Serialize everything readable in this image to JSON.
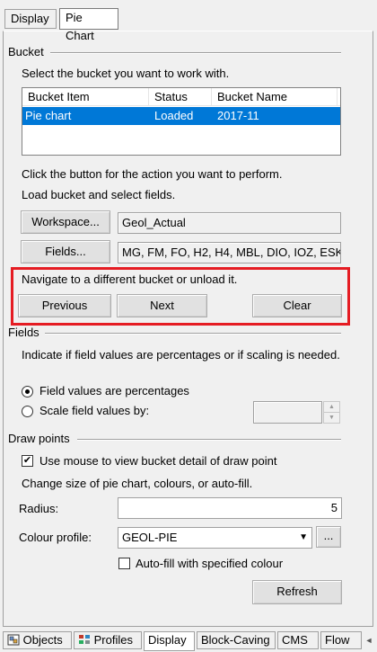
{
  "top_tabs": [
    "Display",
    "Pie Chart"
  ],
  "bucket": {
    "group_title": "Bucket",
    "instruction": "Select the bucket you want to work with.",
    "columns": [
      "Bucket Item",
      "Status",
      "Bucket Name"
    ],
    "rows": [
      {
        "item": "Pie chart",
        "status": "Loaded",
        "name": "2017-11"
      }
    ],
    "action_text": "Click the button for the action you want to perform.",
    "load_text": "Load bucket and select fields.",
    "workspace_button": "Workspace...",
    "workspace_value": "Geol_Actual",
    "fields_button": "Fields...",
    "fields_value": "MG, FM, FO, H2, H4, MBL, DIO, IOZ, ESK,",
    "navigate_text": "Navigate to a different bucket or unload it.",
    "previous_button": "Previous",
    "next_button": "Next",
    "clear_button": "Clear"
  },
  "fields": {
    "group_title": "Fields",
    "instruction": "Indicate if field values are percentages or if scaling is needed.",
    "radio_percent": "Field values are percentages",
    "radio_scale": "Scale field values by:",
    "scale_value": ""
  },
  "draw_points": {
    "group_title": "Draw points",
    "use_mouse_label": "Use mouse to view bucket detail of draw point",
    "change_text": "Change size of pie chart, colours, or auto-fill.",
    "radius_label": "Radius:",
    "radius_value": "5",
    "colour_profile_label": "Colour profile:",
    "colour_profile_value": "GEOL-PIE",
    "browse_button": "...",
    "autofill_label": "Auto-fill with specified colour",
    "refresh_button": "Refresh"
  },
  "bottom_tabs": [
    "Objects",
    "Profiles",
    "Display",
    "Block-Caving",
    "CMS",
    "Flow"
  ]
}
